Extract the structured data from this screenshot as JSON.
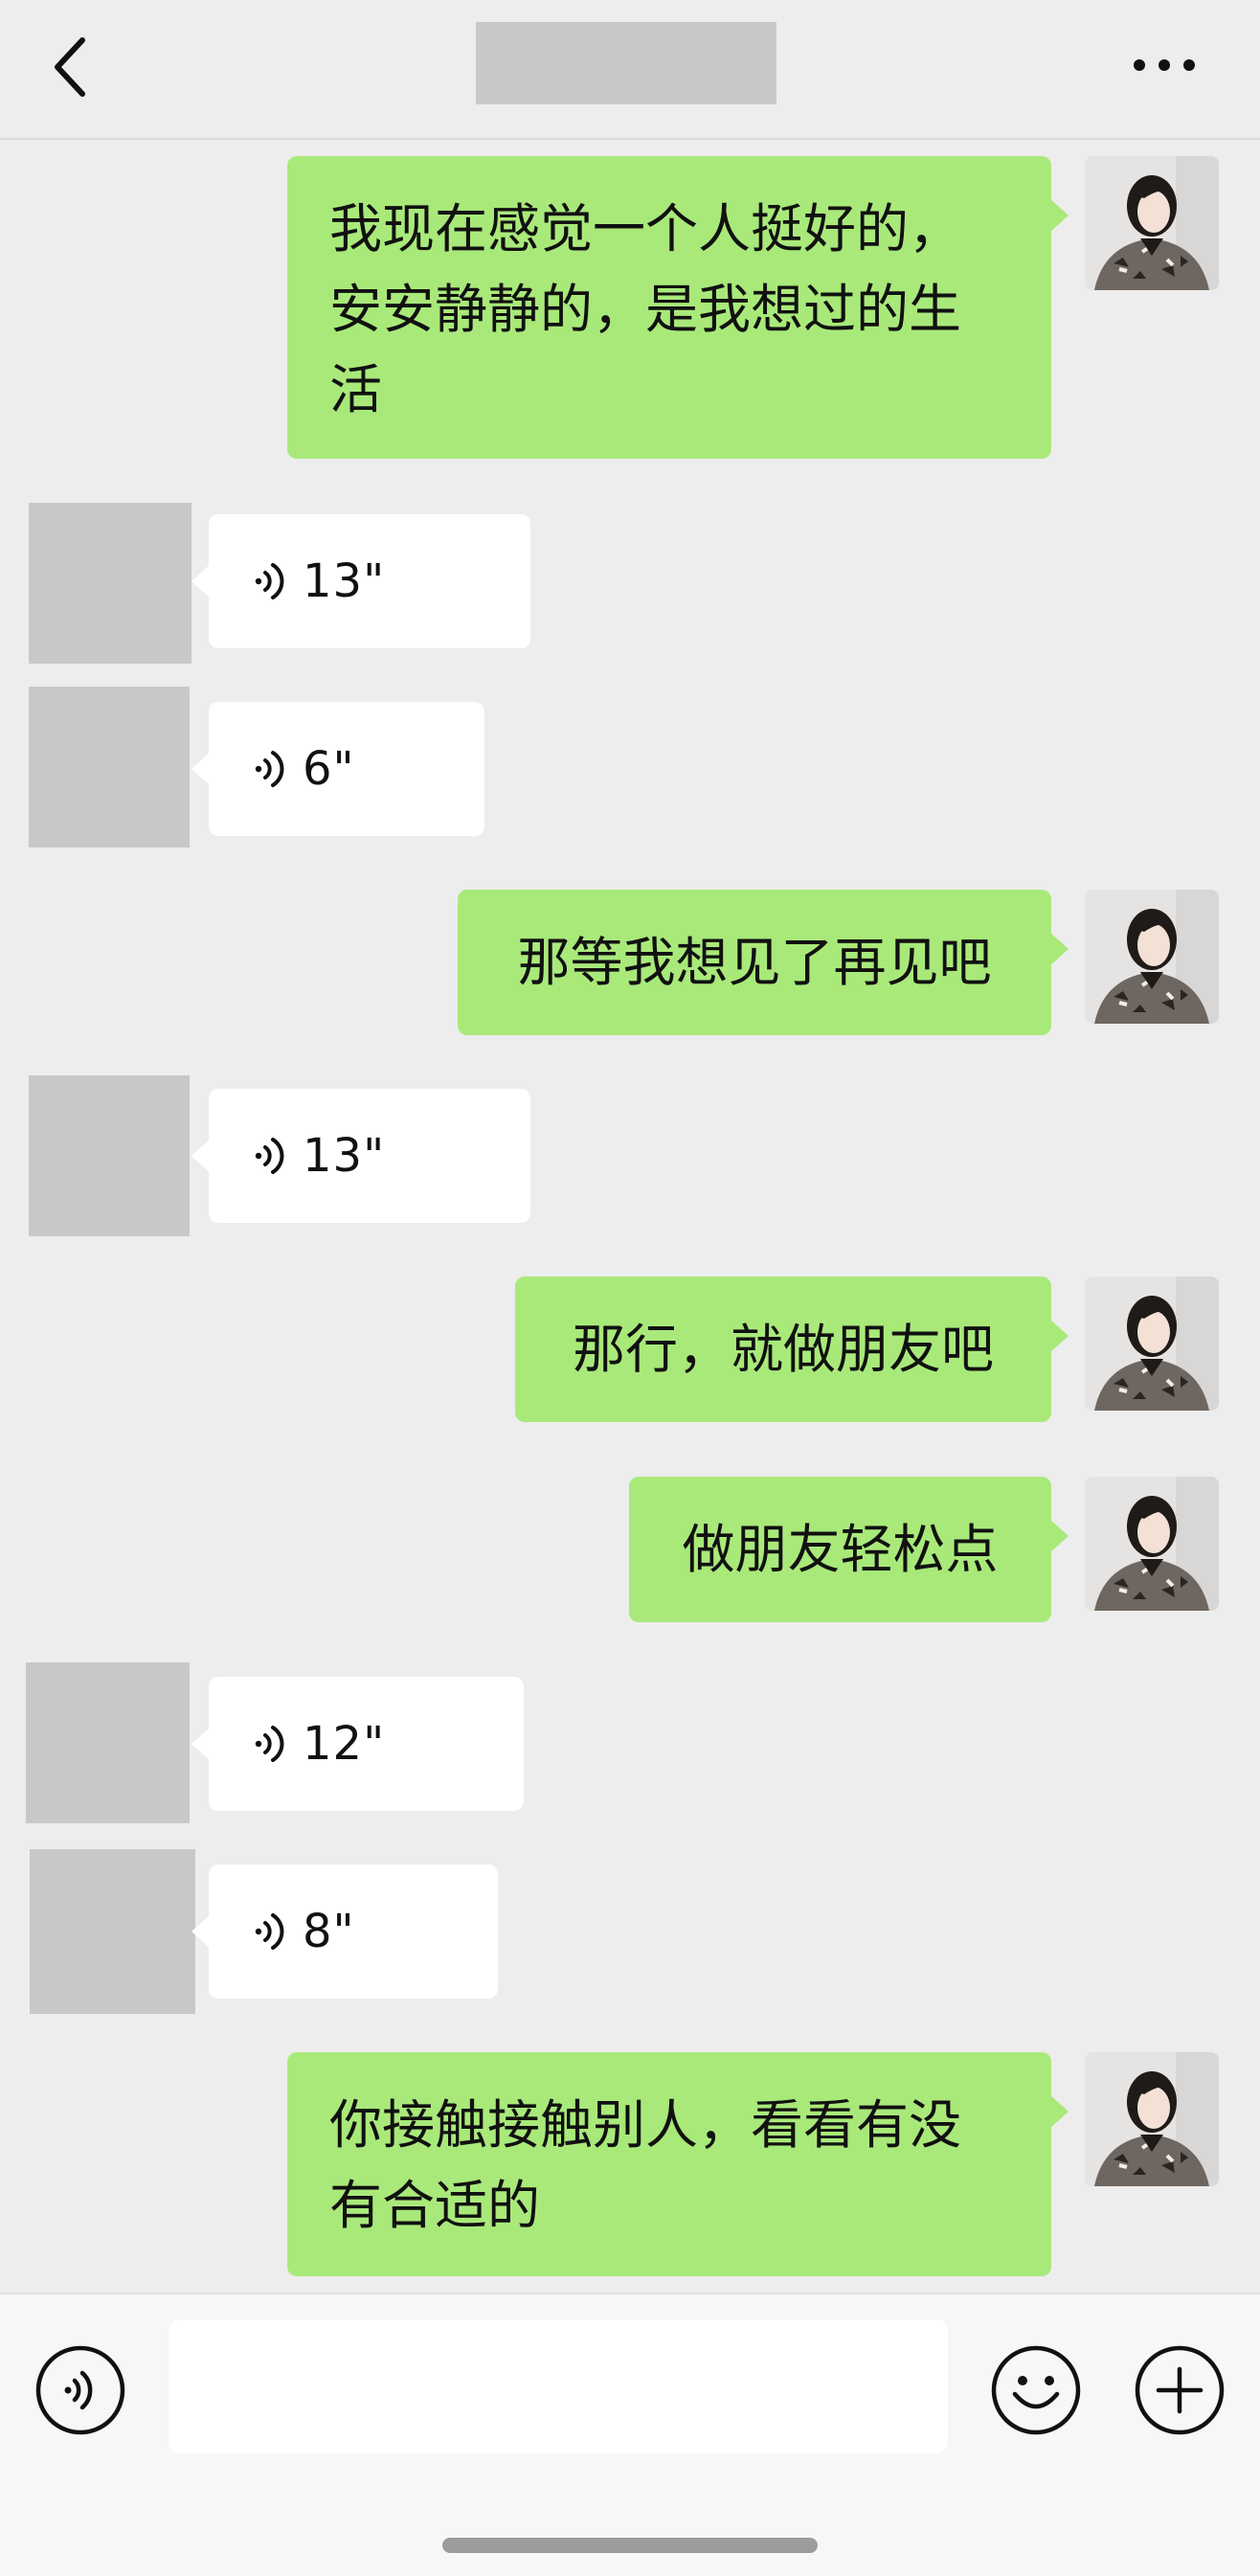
{
  "header": {
    "title": "",
    "back_icon": "chevron-left-icon",
    "more_icon": "more-dots-icon"
  },
  "messages": [
    {
      "from": "me",
      "type": "text",
      "lines": [
        "我现在感觉一个人挺好的，",
        "安安静静的，是我想过的生",
        "活"
      ]
    },
    {
      "from": "other",
      "type": "voice",
      "duration": "13\""
    },
    {
      "from": "other",
      "type": "voice",
      "duration": "6\""
    },
    {
      "from": "me",
      "type": "text",
      "lines": [
        "那等我想见了再见吧"
      ]
    },
    {
      "from": "other",
      "type": "voice",
      "duration": "13\""
    },
    {
      "from": "me",
      "type": "text",
      "lines": [
        "那行，就做朋友吧"
      ]
    },
    {
      "from": "me",
      "type": "text",
      "lines": [
        "做朋友轻松点"
      ]
    },
    {
      "from": "other",
      "type": "voice",
      "duration": "12\""
    },
    {
      "from": "other",
      "type": "voice",
      "duration": "8\""
    },
    {
      "from": "me",
      "type": "text",
      "lines": [
        "你接触接触别人，看看有没",
        "有合适的"
      ]
    }
  ],
  "input_bar": {
    "voice_icon": "voice-input-icon",
    "text_value": "",
    "emoji_icon": "emoji-icon",
    "plus_icon": "plus-icon"
  },
  "colors": {
    "background": "#ededed",
    "my_bubble": "#a9e97a",
    "other_bubble": "#ffffff",
    "redacted": "#c8c8c8"
  }
}
